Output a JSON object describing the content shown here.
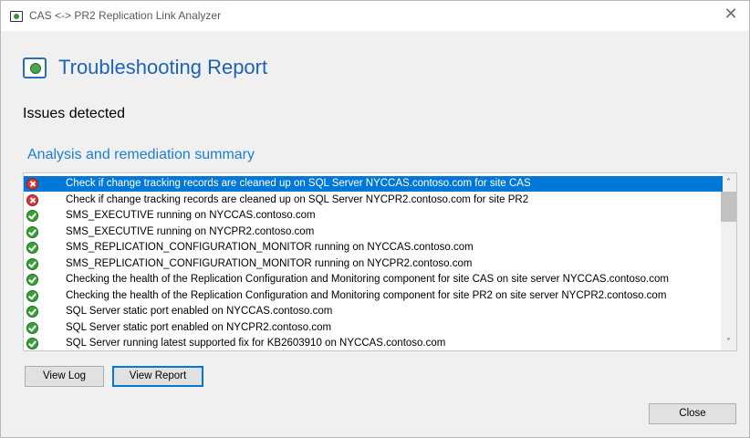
{
  "window": {
    "title": "CAS <-> PR2 Replication Link Analyzer",
    "close_glyph": "✕"
  },
  "header": {
    "icon": "report-icon",
    "title": "Troubleshooting Report"
  },
  "status_heading": "Issues detected",
  "section_heading": "Analysis and remediation summary",
  "results": [
    {
      "status": "error",
      "text": "Check if change tracking records are cleaned up on SQL Server NYCCAS.contoso.com for site CAS",
      "selected": true
    },
    {
      "status": "error",
      "text": "Check if change tracking records are cleaned up on SQL Server NYCPR2.contoso.com for site PR2",
      "selected": false
    },
    {
      "status": "ok",
      "text": "SMS_EXECUTIVE running on NYCCAS.contoso.com",
      "selected": false
    },
    {
      "status": "ok",
      "text": "SMS_EXECUTIVE running on NYCPR2.contoso.com",
      "selected": false
    },
    {
      "status": "ok",
      "text": "SMS_REPLICATION_CONFIGURATION_MONITOR running on NYCCAS.contoso.com",
      "selected": false
    },
    {
      "status": "ok",
      "text": "SMS_REPLICATION_CONFIGURATION_MONITOR running on NYCPR2.contoso.com",
      "selected": false
    },
    {
      "status": "ok",
      "text": "Checking the health of the Replication Configuration and Monitoring component for site CAS on site server NYCCAS.contoso.com",
      "selected": false
    },
    {
      "status": "ok",
      "text": "Checking the health of the Replication Configuration and Monitoring component for site PR2 on site server NYCPR2.contoso.com",
      "selected": false
    },
    {
      "status": "ok",
      "text": "SQL Server static port enabled on NYCCAS.contoso.com",
      "selected": false
    },
    {
      "status": "ok",
      "text": "SQL Server static port enabled on NYCPR2.contoso.com",
      "selected": false
    },
    {
      "status": "ok",
      "text": "SQL Server running latest supported fix for KB2603910 on NYCCAS.contoso.com",
      "selected": false
    }
  ],
  "scrollbar": {
    "up_glyph": "˄",
    "down_glyph": "˅"
  },
  "buttons": {
    "view_log": "View Log",
    "view_report": "View Report",
    "close": "Close"
  },
  "colors": {
    "accent": "#1d63b5",
    "selection": "#0078d7",
    "error": "#d33a3a",
    "ok": "#37a337"
  }
}
